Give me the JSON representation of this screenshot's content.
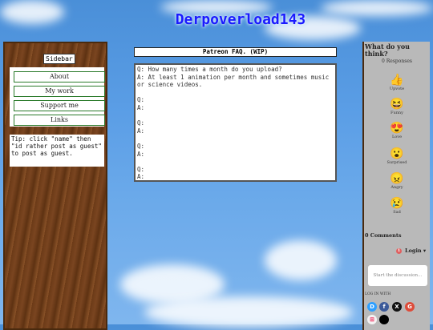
{
  "site": {
    "title": "Derpoverload143"
  },
  "sidebar": {
    "title": "Sidebar",
    "items": [
      {
        "label": "About"
      },
      {
        "label": "My work"
      },
      {
        "label": "Support me"
      },
      {
        "label": "Links"
      }
    ],
    "tip": "Tip: click \"name\" then \"id rather post as guest\" to post as guest."
  },
  "faq": {
    "title": "Patreon FAQ. (WIP)",
    "lines": [
      "Q: How many times a month do you upload?",
      "A: At least 1 animation per month and sometimes music or science videos.",
      "",
      "Q:",
      "A:",
      "",
      "Q:",
      "A:",
      "",
      "Q:",
      "A:",
      "",
      "Q:",
      "A:"
    ]
  },
  "comments": {
    "heading": "What do you think?",
    "responses": "0 Responses",
    "reactions": [
      {
        "icon": "👍",
        "label": "Upvote"
      },
      {
        "icon": "😆",
        "label": "Funny"
      },
      {
        "icon": "😍",
        "label": "Love"
      },
      {
        "icon": "😮",
        "label": "Surprised"
      },
      {
        "icon": "😠",
        "label": "Angry"
      },
      {
        "icon": "😢",
        "label": "Sad"
      }
    ],
    "count": "0 Comments",
    "notifications": "1",
    "login": "Login ▾",
    "placeholder": "Start the discussion…",
    "login_with": "LOG IN WITH",
    "providers": [
      {
        "icon": "D",
        "color": "#2e9fff"
      },
      {
        "icon": "f",
        "color": "#3b5998"
      },
      {
        "icon": "X",
        "color": "#111111"
      },
      {
        "icon": "G",
        "color": "#dd4b39"
      },
      {
        "icon": "⊞",
        "color": "#f3f3f3"
      },
      {
        "icon": "",
        "color": "#000000"
      }
    ]
  }
}
